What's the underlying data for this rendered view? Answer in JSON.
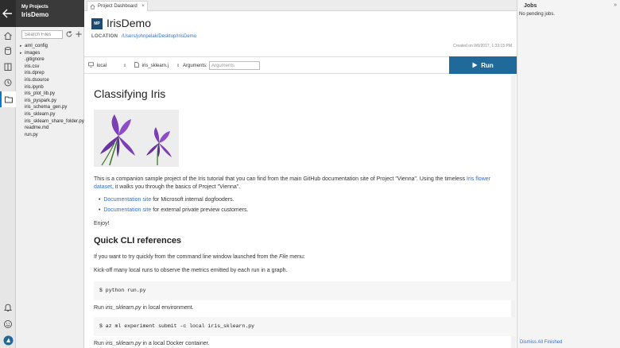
{
  "sidebar": {
    "section_label": "My Projects",
    "project_name": "IrisDemo",
    "search_placeholder": "Search Files",
    "files": [
      {
        "name": "aml_config",
        "folder": true
      },
      {
        "name": "images",
        "folder": true
      },
      {
        "name": ".gitignore",
        "folder": false
      },
      {
        "name": "iris.csv",
        "folder": false
      },
      {
        "name": "iris.dprep",
        "folder": false
      },
      {
        "name": "iris.dsource",
        "folder": false
      },
      {
        "name": "iris.ipynb",
        "folder": false
      },
      {
        "name": "iris_plot_lib.py",
        "folder": false
      },
      {
        "name": "iris_pyspark.py",
        "folder": false
      },
      {
        "name": "iris_schema_gen.py",
        "folder": false
      },
      {
        "name": "iris_sklearn.py",
        "folder": false
      },
      {
        "name": "iris_sklearn_share_folder.py",
        "folder": false
      },
      {
        "name": "readme.md",
        "folder": false
      },
      {
        "name": "run.py",
        "folder": false
      }
    ]
  },
  "tabs": [
    {
      "label": "Project Dashboard"
    }
  ],
  "header": {
    "logo": "MP",
    "title": "IrisDemo",
    "location_label": "LOCATION",
    "location_path": "/Users/johnpelak/Desktop/IrisDemo",
    "created": "Created on 9/6/2017, 1:33:15 PM"
  },
  "runbar": {
    "target": "local",
    "script": "iris_sklearn.j",
    "args_label": "Arguments:",
    "args_placeholder": "Arguments",
    "run_label": "Run"
  },
  "content": {
    "title": "Classifying Iris",
    "intro_a": "This is a companion sample project of the Iris tutorial that you can find from the main GitHub documentation site of Project \"Vienna\". Using the timeless ",
    "intro_link": "Iris flower",
    "intro_link2": "dataset",
    "intro_b": ", it walks you through the basics of Project \"Vienna\".",
    "bullets": [
      {
        "link": "Documentation site",
        "text": " for Microsoft internal dogfooders."
      },
      {
        "link": "Documentation site",
        "text": " for external private preview customers."
      }
    ],
    "enjoy": "Enjoy!",
    "section_title": "Quick CLI references",
    "cli_a": "If you want to try quickly from the command line window launched from the ",
    "cli_italic": "File",
    "cli_b": " menu:",
    "kickoff": "Kick-off many local runs to observe the metrics emitted by each run in a graph.",
    "code1": "$ python run.py",
    "run1_a": "Run ",
    "run1_italic": "iris_sklearn.py",
    "run1_b": " in local environment.",
    "code2": "$ az ml experiment submit -c local iris_sklearn.py",
    "run2_a": "Run ",
    "run2_italic": "iris_sklearn.py",
    "run2_b": " in a local Docker container."
  },
  "jobs": {
    "title": "Jobs",
    "empty": "No pending jobs.",
    "dismiss": "Dismiss All Finished"
  },
  "colors": {
    "accent": "#1f6a9a",
    "link": "#2f6fd1",
    "dark_header": "#3a3a3a",
    "flower_purple": "#7b3fb5"
  },
  "icons": [
    "back-arrow-icon",
    "home-icon",
    "database-icon",
    "notebook-icon",
    "history-icon",
    "folder-icon",
    "bell-icon",
    "smiley-icon",
    "azure-icon",
    "refresh-icon",
    "plus-icon",
    "play-icon",
    "collapse-icon"
  ]
}
